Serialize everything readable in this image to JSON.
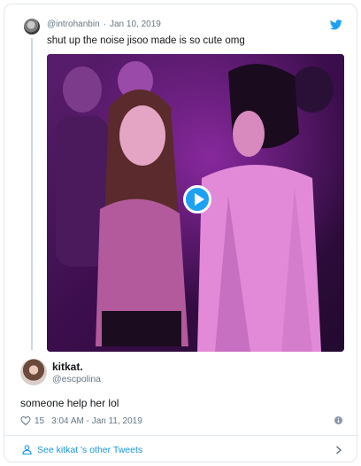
{
  "quoted_tweet": {
    "handle": "@introhanbin",
    "date": "Jan 10, 2019",
    "text": "shut up the noise jisoo made is so cute omg"
  },
  "author": {
    "name": "kitkat.",
    "handle": "@escpolina"
  },
  "tweet": {
    "text": "someone help her lol",
    "like_count": "15",
    "timestamp": "3:04 AM - Jan 11, 2019"
  },
  "footer": {
    "link_text": "See kitkat 's other Tweets"
  },
  "colors": {
    "accent": "#1da1f2",
    "link": "#1b95e0",
    "muted": "#657786",
    "border": "#e1e8ed"
  },
  "icons": [
    "twitter-bird-icon",
    "play-icon",
    "heart-icon",
    "info-icon",
    "user-icon",
    "chevron-right-icon"
  ]
}
